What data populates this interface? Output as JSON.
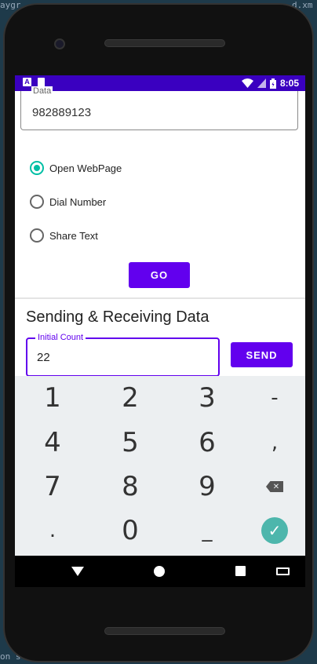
{
  "background": {
    "left_top": "aygr",
    "right_top": "d.xm",
    "bottom_left": "on s"
  },
  "status_bar": {
    "time": "8:05",
    "app_icon_letter": "A",
    "icons": [
      "notification-a-icon",
      "sd-card-icon",
      "wifi-icon",
      "signal-icon",
      "battery-icon"
    ]
  },
  "data_field": {
    "label": "Data",
    "value": "982889123"
  },
  "radio_options": [
    {
      "label": "Open WebPage",
      "checked": true
    },
    {
      "label": "Dial Number",
      "checked": false
    },
    {
      "label": "Share Text",
      "checked": false
    }
  ],
  "go_button": "GO",
  "section_title": "Sending & Receiving Data",
  "count_field": {
    "label": "Initial Count",
    "value": "22"
  },
  "send_button": "SEND",
  "keyboard": {
    "rows": [
      [
        "1",
        "2",
        "3",
        "-"
      ],
      [
        "4",
        "5",
        "6",
        ","
      ],
      [
        "7",
        "8",
        "9",
        "backspace"
      ],
      [
        ".",
        "0",
        "_",
        "done"
      ]
    ]
  },
  "colors": {
    "primary": "#6200ee",
    "status_bar": "#3a00c0",
    "radio_accent": "#00bfa5",
    "done_key": "#4db6ac"
  }
}
